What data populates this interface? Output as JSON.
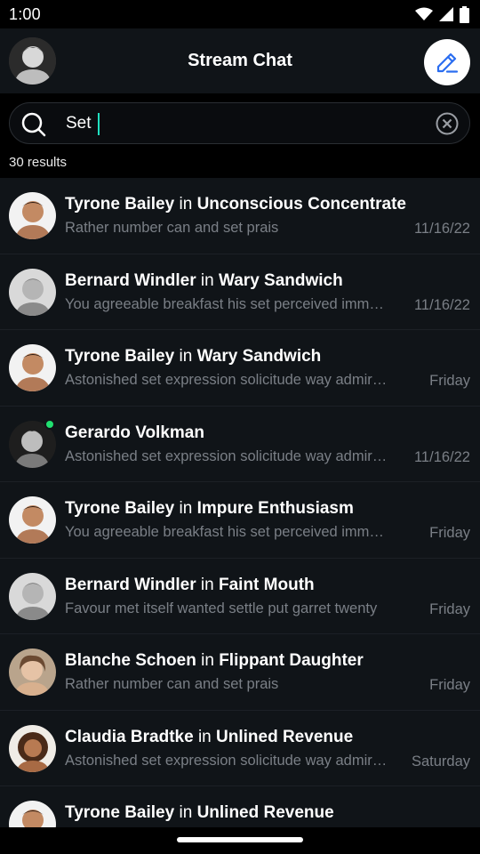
{
  "status_bar": {
    "time": "1:00",
    "icons": [
      "wifi-icon",
      "signal-icon",
      "battery-icon"
    ]
  },
  "header": {
    "title": "Stream Chat",
    "compose_icon": "pencil-icon"
  },
  "search": {
    "value": "Set",
    "placeholder": "",
    "clear_icon": "clear-icon"
  },
  "results": {
    "count_label": "30 results"
  },
  "colors": {
    "background": "#101418",
    "accent": "#2a6df0",
    "online": "#20e070",
    "caret": "#20e0c0",
    "muted_text": "#7a7f86"
  },
  "messages": [
    {
      "user": "Tyrone Bailey",
      "in": "in",
      "channel": "Unconscious Concentrate",
      "preview": "Rather number can and set prais",
      "date": "11/16/22",
      "online": false
    },
    {
      "user": "Bernard Windler",
      "in": "in",
      "channel": "Wary Sandwich",
      "preview": "You agreeable breakfast his set perceived immediately",
      "date": "11/16/22",
      "online": false
    },
    {
      "user": "Tyrone Bailey",
      "in": "in",
      "channel": "Wary Sandwich",
      "preview": "Astonished set expression solicitude way admiration",
      "date": "Friday",
      "online": false
    },
    {
      "user": "Gerardo Volkman",
      "in": "",
      "channel": "",
      "preview": "Astonished set expression solicitude way admiration",
      "date": "11/16/22",
      "online": true
    },
    {
      "user": "Tyrone Bailey",
      "in": "in",
      "channel": "Impure Enthusiasm",
      "preview": "You agreeable breakfast his set perceived immediately",
      "date": "Friday",
      "online": false
    },
    {
      "user": "Bernard Windler",
      "in": "in",
      "channel": "Faint Mouth",
      "preview": "Favour met itself wanted settle put garret twenty",
      "date": "Friday",
      "online": false
    },
    {
      "user": "Blanche Schoen",
      "in": "in",
      "channel": "Flippant Daughter",
      "preview": "Rather number can and set prais",
      "date": "Friday",
      "online": false
    },
    {
      "user": "Claudia Bradtke",
      "in": "in",
      "channel": "Unlined Revenue",
      "preview": "Astonished set expression solicitude way admiration",
      "date": "Saturday",
      "online": false
    },
    {
      "user": "Tyrone Bailey",
      "in": "in",
      "channel": "Unlined Revenue",
      "preview": "",
      "date": "",
      "online": false
    }
  ]
}
